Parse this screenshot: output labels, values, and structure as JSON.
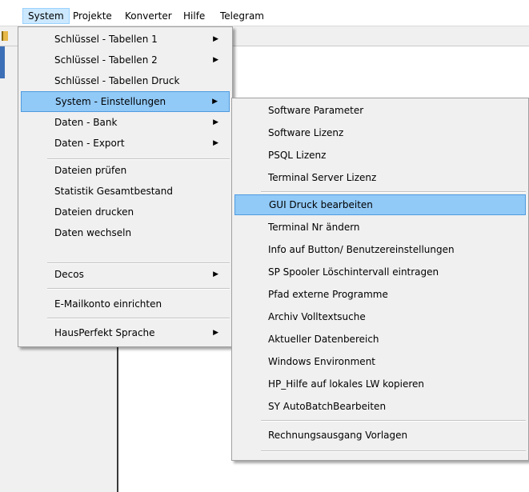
{
  "menubar": {
    "items": [
      {
        "label": "System"
      },
      {
        "label": "Projekte"
      },
      {
        "label": "Konverter"
      },
      {
        "label": "Hilfe"
      },
      {
        "label": "Telegram"
      }
    ]
  },
  "system_menu": {
    "items": [
      {
        "label": "Schlüssel - Tabellen 1",
        "submenu": true
      },
      {
        "label": "Schlüssel - Tabellen 2",
        "submenu": true
      },
      {
        "label": "Schlüssel - Tabellen Druck",
        "submenu": false
      },
      {
        "label": "System - Einstellungen",
        "submenu": true,
        "highlighted": true
      },
      {
        "label": "Daten - Bank",
        "submenu": true
      },
      {
        "label": "Daten - Export",
        "submenu": true
      },
      {
        "label": "Dateien prüfen",
        "submenu": false
      },
      {
        "label": "Statistik Gesamtbestand",
        "submenu": false
      },
      {
        "label": "Dateien drucken",
        "submenu": false
      },
      {
        "label": "Daten wechseln",
        "submenu": false
      },
      {
        "label": "Decos",
        "submenu": true
      },
      {
        "label": "E-Mailkonto einrichten",
        "submenu": false
      },
      {
        "label": "HausPerfekt Sprache",
        "submenu": true
      }
    ]
  },
  "settings_submenu": {
    "items": [
      {
        "label": "Software Parameter"
      },
      {
        "label": "Software Lizenz"
      },
      {
        "label": "PSQL Lizenz"
      },
      {
        "label": "Terminal Server Lizenz"
      },
      {
        "label": "GUI Druck bearbeiten",
        "highlighted": true
      },
      {
        "label": "Terminal Nr ändern"
      },
      {
        "label": "Info auf Button/ Benutzereinstellungen"
      },
      {
        "label": "SP Spooler Löschintervall  eintragen"
      },
      {
        "label": "Pfad externe Programme"
      },
      {
        "label": "Archiv Volltextsuche"
      },
      {
        "label": "Aktueller Datenbereich"
      },
      {
        "label": "Windows Environment"
      },
      {
        "label": "HP_Hilfe auf lokales LW kopieren"
      },
      {
        "label": "SY AutoBatchBearbeiten"
      },
      {
        "label": "Rechnungsausgang Vorlagen"
      }
    ]
  },
  "colors": {
    "highlight": "#91c9f7",
    "highlight_border": "#4f9be0",
    "menubar_active": "#cce8ff"
  }
}
